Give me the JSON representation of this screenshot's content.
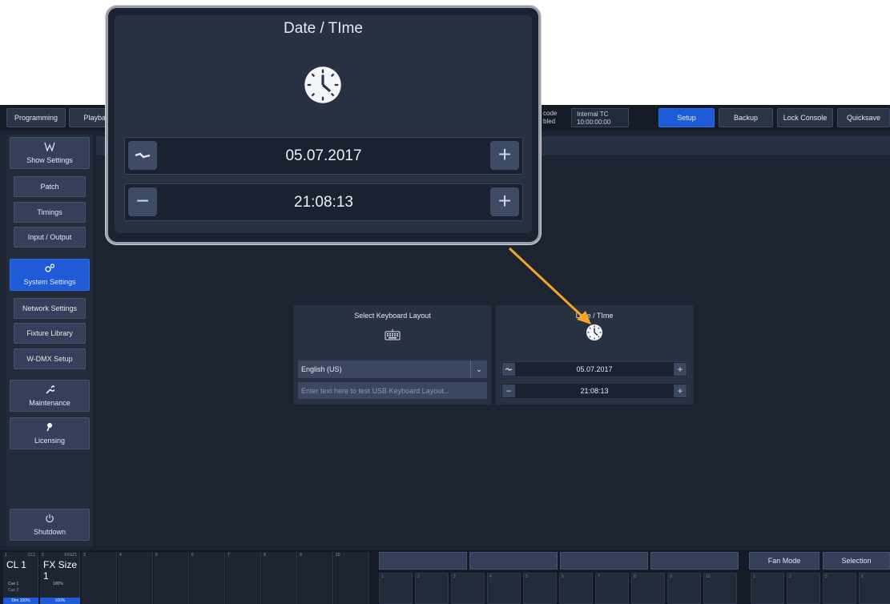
{
  "topbar": {
    "tabs": [
      {
        "label": "Programming"
      },
      {
        "label": "Playback"
      }
    ],
    "timecode_partial": {
      "line1": "code",
      "line2": "bled"
    },
    "internal_tc": {
      "line1": "Internal TC",
      "line2": "10:00:00:00"
    },
    "buttons": [
      {
        "label": "Setup",
        "active": true
      },
      {
        "label": "Backup"
      },
      {
        "label": "Lock Console"
      },
      {
        "label": "Quicksave"
      }
    ]
  },
  "sidebar": {
    "show_settings": "Show Settings",
    "patch": "Patch",
    "timings": "Timings",
    "input_output": "Input / Output",
    "system_settings": "System Settings",
    "network_settings": "Network Settings",
    "fixture_library": "Fixture Library",
    "wdmx_setup": "W-DMX Setup",
    "maintenance": "Maintenance",
    "licensing": "Licensing",
    "shutdown": "Shutdown"
  },
  "keyboard_panel": {
    "title": "Select Keyboard Layout",
    "icon": "keyboard-icon",
    "layout_value": "English (US)",
    "test_placeholder": "Enter text here to test USB Keyboard Layout..."
  },
  "datetime_panel": {
    "title": "Date / TIme",
    "icon": "clock-icon",
    "date": "05.07.2017",
    "time": "21:08:13"
  },
  "zoom": {
    "title": "Date / TIme",
    "date": "05.07.2017",
    "time": "21:08:13"
  },
  "bottom": {
    "cell1": {
      "num": "1",
      "tag": "CL1",
      "name": "CL 1",
      "cue": "Cue 1",
      "cue2": "Cue 2",
      "dim": "Dim 100%"
    },
    "cell2": {
      "num": "2",
      "tag": "FXSZ1",
      "name": "FX Size 1",
      "pct": "100%",
      "dim": "100%"
    },
    "fan_mode": "Fan Mode",
    "selection": "Selection"
  },
  "colors": {
    "accent": "#1f5bd6",
    "arrow": "#f2a623"
  }
}
